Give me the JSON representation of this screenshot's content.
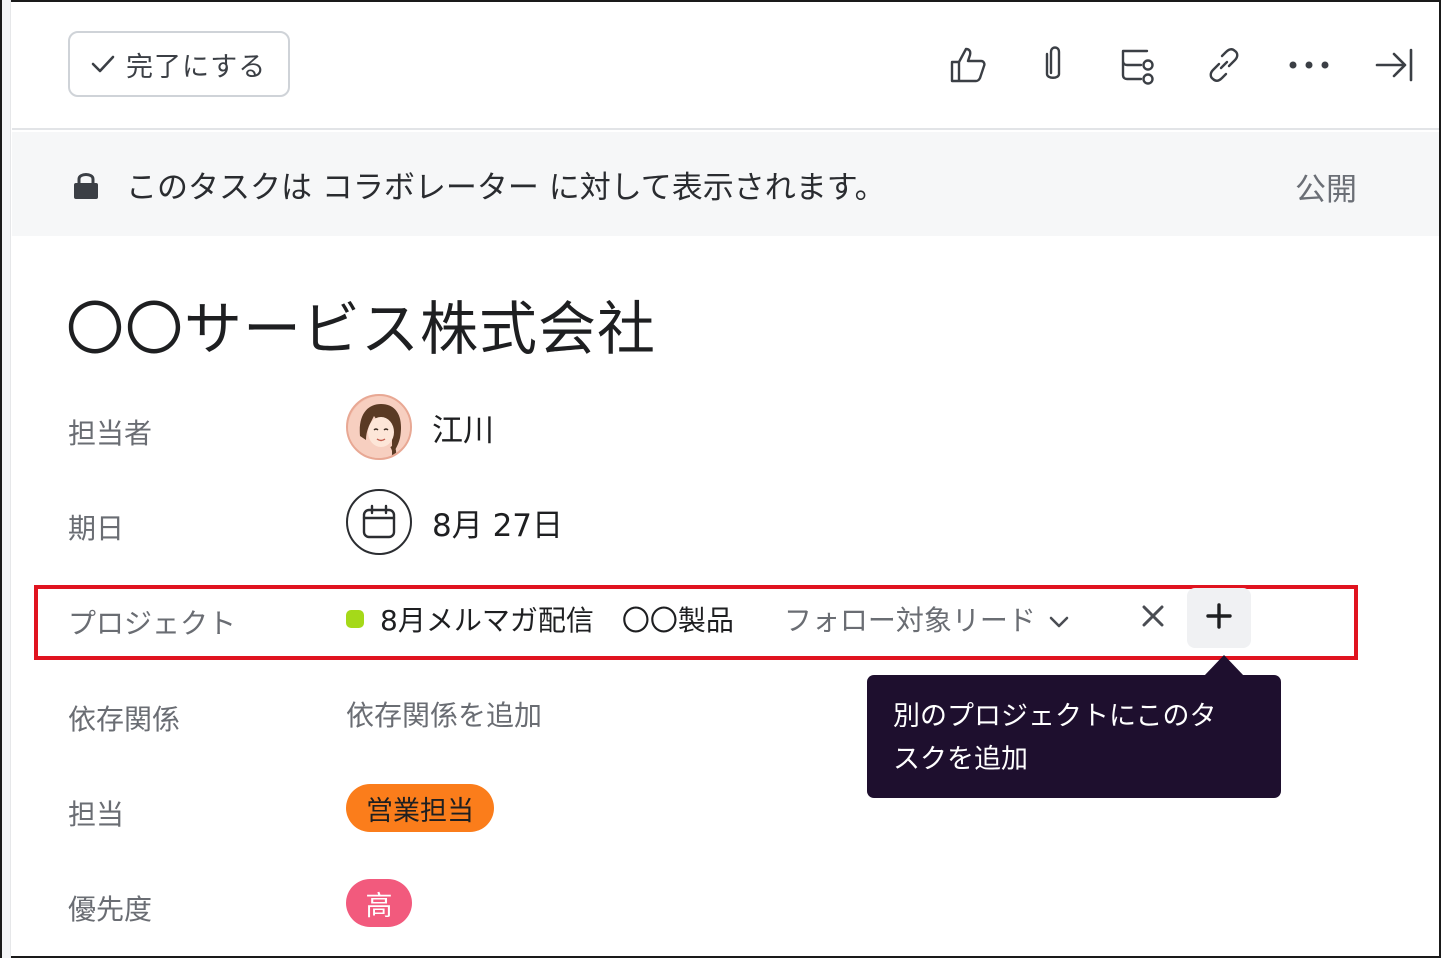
{
  "toolbar": {
    "complete_label": "完了にする",
    "icons": [
      "thumbs-up-icon",
      "attachment-icon",
      "subtask-icon",
      "link-icon",
      "more-icon",
      "close-panel-icon"
    ]
  },
  "banner": {
    "message": "このタスクは コラボレーター に対して表示されます。",
    "public_label": "公開"
  },
  "task": {
    "title": "〇〇サービス株式会社"
  },
  "fields": {
    "assignee": {
      "label": "担当者",
      "name": "江川"
    },
    "due_date": {
      "label": "期日",
      "value": "8月 27日"
    },
    "projects": {
      "label": "プロジェクト",
      "project_name": "8月メルマガ配信",
      "project_name_2": "〇〇製品",
      "section": "フォロー対象リード",
      "project_color": "#a5d919"
    },
    "dependencies": {
      "label": "依存関係",
      "placeholder": "依存関係を追加"
    },
    "owner": {
      "label": "担当",
      "value": "営業担当",
      "color": "#fb7d1b"
    },
    "priority": {
      "label": "優先度",
      "value": "高",
      "color": "#f25a7d"
    }
  },
  "tooltip": {
    "text_line1": "別のプロジェクトにこのタ",
    "text_line2": "スクを追加"
  },
  "highlight_color": "#e0131f"
}
